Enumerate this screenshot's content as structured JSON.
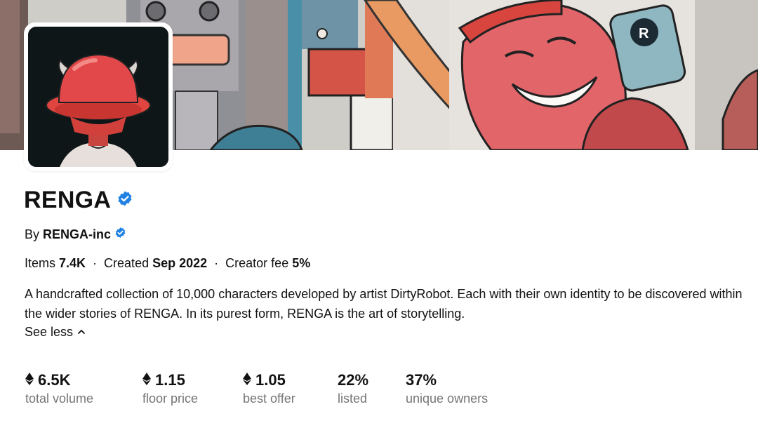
{
  "collection": {
    "name": "RENGA",
    "verified": true,
    "creator_prefix": "By",
    "creator_name": "RENGA-inc",
    "creator_verified": true
  },
  "meta": {
    "items_label": "Items",
    "items_value": "7.4K",
    "created_label": "Created",
    "created_value": "Sep 2022",
    "fee_label": "Creator fee",
    "fee_value": "5%",
    "separator": "·"
  },
  "description": "A handcrafted collection of 10,000 characters developed by artist DirtyRobot. Each with their own identity to be discovered within the wider stories of RENGA. In its purest form, RENGA is the art of storytelling.",
  "see_less": {
    "label": "See less",
    "icon": "chevron-up-icon"
  },
  "stats": [
    {
      "value": "6.5K",
      "label": "total volume",
      "icon": "ethereum-icon"
    },
    {
      "value": "1.15",
      "label": "floor price",
      "icon": "ethereum-icon"
    },
    {
      "value": "1.05",
      "label": "best offer",
      "icon": "ethereum-icon"
    },
    {
      "value": "22%",
      "label": "listed"
    },
    {
      "value": "37%",
      "label": "unique owners"
    }
  ],
  "colors": {
    "verified_badge": "#2081e2",
    "text_primary": "#121212",
    "text_secondary": "#757575",
    "hat_red": "#e2484a"
  }
}
